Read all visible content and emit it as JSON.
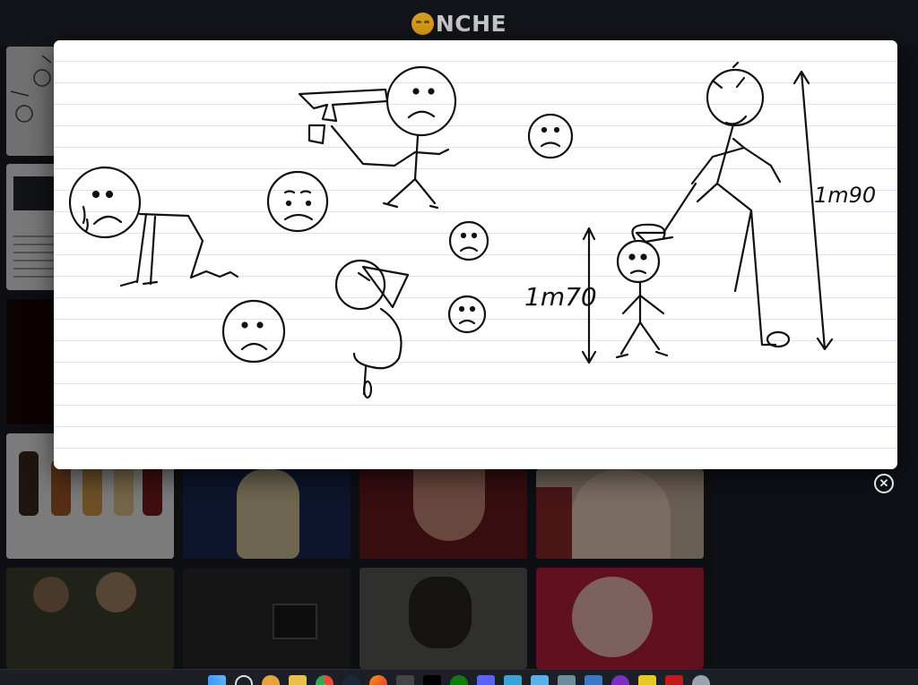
{
  "header": {
    "logo_text": "NCHE",
    "logo_icon": "onche-face-logo"
  },
  "modal": {
    "image_label": "Stick figure drawing on lined paper",
    "annotations": {
      "left_height": "1m70",
      "right_height": "1m90"
    }
  },
  "close_button": {
    "glyph": "✕",
    "icon": "close-icon"
  },
  "colors": {
    "background": "#0d0f13",
    "header": "#121419",
    "accent": "#d39c1a",
    "modal_bg": "#ffffff",
    "ruled_line": "#d6e6f2"
  },
  "taskbar": {
    "icons": [
      "windows-start-icon",
      "search-icon",
      "media-player-icon",
      "file-explorer-icon",
      "chrome-icon",
      "steam-icon",
      "firefox-icon",
      "screenshot-icon",
      "tiktok-icon",
      "xbox-icon",
      "discord-icon",
      "keyboard-icon",
      "notepad-icon",
      "teams-icon",
      "calculator-icon",
      "app-icon",
      "app-icon-2",
      "app-icon-3",
      "settings-icon"
    ]
  }
}
